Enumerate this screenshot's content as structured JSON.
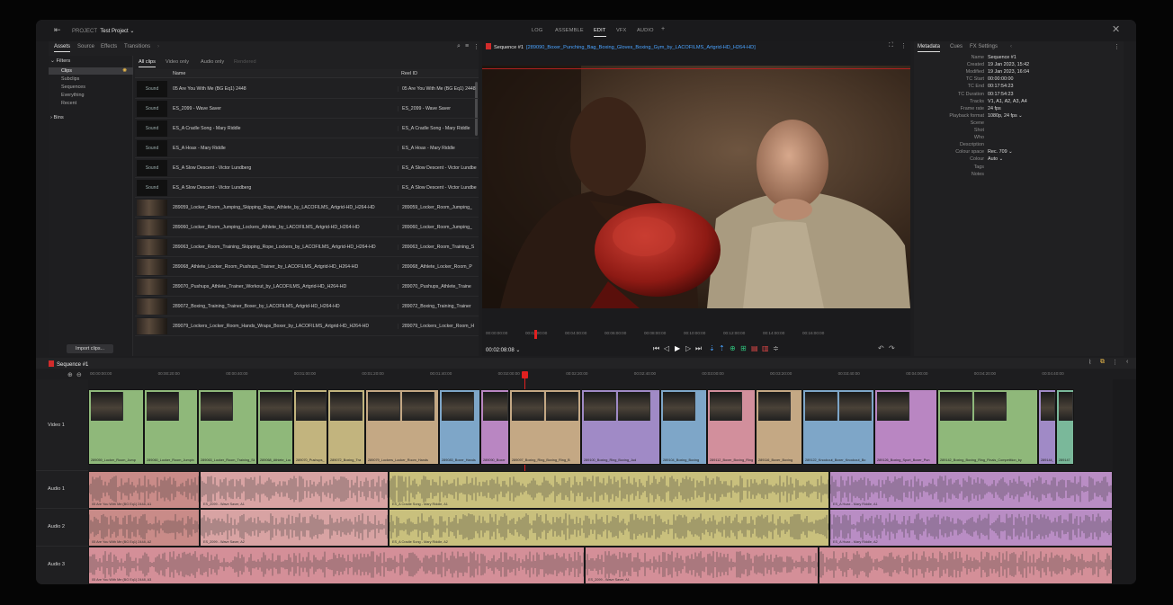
{
  "topbar": {
    "project_label": "PROJECT",
    "project_name": "Test Project ⌄",
    "tabs": [
      "LOG",
      "ASSEMBLE",
      "EDIT",
      "VFX",
      "AUDIO",
      "+"
    ],
    "active_tab": "EDIT"
  },
  "pool": {
    "tabs": [
      "Assets",
      "Source",
      "Effects",
      "Transitions",
      "›"
    ],
    "filters_title": "Filters",
    "filters": [
      "Clips",
      "Subclips",
      "Sequences",
      "Everything",
      "Recent"
    ],
    "bins_title": "Bins",
    "clip_tabs": [
      "All clips",
      "Video only",
      "Audio only",
      "Rendered"
    ],
    "col_name": "Name",
    "col_reel": "Reel ID",
    "sound_label": "Sound",
    "rows": [
      {
        "name": "05 Are You With Me (BG Eq1) 2448",
        "reel": "05 Are You With Me (BG Eq1) 2448",
        "sound": true
      },
      {
        "name": "ES_2099 - Wave Saver",
        "reel": "ES_2099 - Wave Saver",
        "sound": true
      },
      {
        "name": "ES_A Cradle Song - Mary Riddle",
        "reel": "ES_A Cradle Song - Mary Riddle",
        "sound": true
      },
      {
        "name": "ES_A Hoax - Mary Riddle",
        "reel": "ES_A Hoax - Mary Riddle",
        "sound": true
      },
      {
        "name": "ES_A Slow Descent - Victor Lundberg",
        "reel": "ES_A Slow Descent - Victor Lundberg",
        "sound": true
      },
      {
        "name": "ES_A Slow Descent - Victor Lundberg",
        "reel": "ES_A Slow Descent - Victor Lundberg",
        "sound": true
      },
      {
        "name": "289059_Locker_Room_Jumping_Skipping_Rope_Athlete_by_LACOFILMS_Artgrid-HD_H264-HD",
        "reel": "289059_Locker_Room_Jumping_",
        "sound": false
      },
      {
        "name": "289060_Locker_Room_Jumping_Lockers_Athlete_by_LACOFILMS_Artgrid-HD_H264-HD",
        "reel": "289060_Locker_Room_Jumping_",
        "sound": false
      },
      {
        "name": "289063_Locker_Room_Training_Skipping_Rope_Lockers_by_LACOFILMS_Artgrid-HD_H264-HD",
        "reel": "289063_Locker_Room_Training_S",
        "sound": false
      },
      {
        "name": "289068_Athlete_Locker_Room_Pushups_Trainer_by_LACOFILMS_Artgrid-HD_H264-HD",
        "reel": "289068_Athlete_Locker_Room_P",
        "sound": false
      },
      {
        "name": "289070_Pushups_Athlete_Trainer_Workout_by_LACOFILMS_Artgrid-HD_H264-HD",
        "reel": "289070_Pushups_Athlete_Traine",
        "sound": false
      },
      {
        "name": "289072_Boxing_Training_Trainer_Boxer_by_LACOFILMS_Artgrid-HD_H264-HD",
        "reel": "289072_Boxing_Training_Trainer",
        "sound": false
      },
      {
        "name": "289079_Lockers_Locker_Room_Hands_Wraps_Boxer_by_LACOFILMS_Artgrid-HD_H264-HD",
        "reel": "289079_Lockers_Locker_Room_H",
        "sound": false
      }
    ],
    "import_label": "Import clips..."
  },
  "viewer": {
    "sequence": "Sequence #1",
    "clip": "[289090_Boxer_Punching_Bag_Boxing_Gloves_Boxing_Gym_by_LACOFILMS_Artgrid-HD_H264-HD]",
    "timecode": "00:02:08:08",
    "ruler": [
      "00:00:00:00",
      "00:02:00:00",
      "00:04:00:00",
      "00:06:00:00",
      "00:08:00:00",
      "00:10:00:00",
      "00:12:00:00",
      "00:14:00:00",
      "00:16:00:00"
    ]
  },
  "meta": {
    "tabs": [
      "Metadata",
      "Cues",
      "FX Settings",
      "‹"
    ],
    "fields": [
      [
        "Name",
        "Sequence #1"
      ],
      [
        "Created",
        "19 Jan 2023, 15:42"
      ],
      [
        "Modified",
        "19 Jan 2023, 16:04"
      ],
      [
        "TC Start",
        "00:00:00:00"
      ],
      [
        "TC End",
        "00:17:54:23"
      ],
      [
        "TC Duration",
        "00:17:54:23"
      ],
      [
        "Tracks",
        "V1, A1, A2, A3, A4"
      ],
      [
        "Frame rate",
        "24 fps"
      ],
      [
        "Playback format",
        "1080p, 24 fps ⌄"
      ],
      [
        "Scene",
        ""
      ],
      [
        "Shot",
        ""
      ],
      [
        "Who",
        ""
      ],
      [
        "Description",
        ""
      ],
      [
        "Colour space",
        "Rec. 709 ⌄"
      ],
      [
        "Colour",
        "Auto ⌄"
      ],
      [
        "Tags",
        ""
      ],
      [
        "Notes",
        ""
      ]
    ]
  },
  "timeline": {
    "title": "Sequence #1",
    "ruler": [
      "00:00:00:00",
      "00:00:20:00",
      "00:00:40:00",
      "00:01:00:00",
      "00:01:20:00",
      "00:01:40:00",
      "00:02:00:00",
      "00:02:20:00",
      "00:02:40:00",
      "00:03:00:00",
      "00:03:20:00",
      "00:03:40:00",
      "00:04:00:00",
      "00:04:20:00",
      "00:04:40:00"
    ],
    "tracks": [
      "Video 1",
      "Audio 1",
      "Audio 2",
      "Audio 3"
    ],
    "video_clips": [
      {
        "label": "289059_Locker_Room_Jump",
        "color": "#8fb87a"
      },
      {
        "label": "289060_Locker_Room_Jumpin",
        "color": "#8fb87a"
      },
      {
        "label": "289063_Locker_Room_Training_Ski",
        "color": "#8fb87a"
      },
      {
        "label": "289068_Athlete_Locker_R",
        "color": "#8fb87a"
      },
      {
        "label": "289070_Pushups_",
        "color": "#c2b47e"
      },
      {
        "label": "289072_Boxing_Tra",
        "color": "#c2b47e"
      },
      {
        "label": "289079_Lockers_Locker_Room_Hands",
        "color": "#c4a884"
      },
      {
        "label": "289083_Boxer_Hands",
        "color": "#7ea6c8"
      },
      {
        "label": "289090_Boxer",
        "color": "#b986c2"
      },
      {
        "label": "289097_Boxing_Ring_Boxing_Ring_B",
        "color": "#c4a884"
      },
      {
        "label": "289100_Boxing_Ring_Boxing_Jud",
        "color": "#a08ac6"
      },
      {
        "label": "289104_Boxing_Boxing",
        "color": "#7ea6c8"
      },
      {
        "label": "289112_Boxer_Boxing_Ring",
        "color": "#d28f9c"
      },
      {
        "label": "289116_Boxer_Boxing",
        "color": "#c4a884"
      },
      {
        "label": "289122_Knockout_Boxer_Knockout_Bo",
        "color": "#7ea6c8"
      },
      {
        "label": "289126_Boxing_Sport_Boxer_Pun",
        "color": "#b986c2"
      },
      {
        "label": "289142_Boxing_Boxing_Ring_Finals_Competition_by",
        "color": "#8fb87a"
      },
      {
        "label": "289144_E",
        "color": "#a08ac6"
      },
      {
        "label": "289147",
        "color": "#7ab89a"
      }
    ],
    "a1": [
      {
        "label": "05 Are You With Me (BG Eq1) 2448, A1",
        "color": "#c98b88"
      },
      {
        "label": "ES_2099 - Wave Saver, A1",
        "color": "#d8a3a3"
      },
      {
        "label": "ES_A Cradle Song - Mary Riddle, A1",
        "color": "#c9c07d"
      },
      {
        "label": "ES_A Hoax - Mary Riddle, A1",
        "color": "#b98dc4"
      }
    ],
    "a2": [
      {
        "label": "05 Are You With Me (BG Eq1) 2448, A2",
        "color": "#c98b88"
      },
      {
        "label": "ES_2099 - Wave Saver, A2",
        "color": "#d8a3a3"
      },
      {
        "label": "ES_A Cradle Song - Mary Riddle, A2",
        "color": "#c9c07d"
      },
      {
        "label": "ES_A Hoax - Mary Riddle, A2",
        "color": "#b98dc4"
      }
    ],
    "a3": [
      {
        "label": "05 Are You With Me (BG Eq1) 2448, A3",
        "color": "#d48f98"
      },
      {
        "label": "ES_2099 - Wave Saver, A1",
        "color": "#d48f98"
      },
      {
        "label": "",
        "color": "#d48f98"
      }
    ]
  }
}
